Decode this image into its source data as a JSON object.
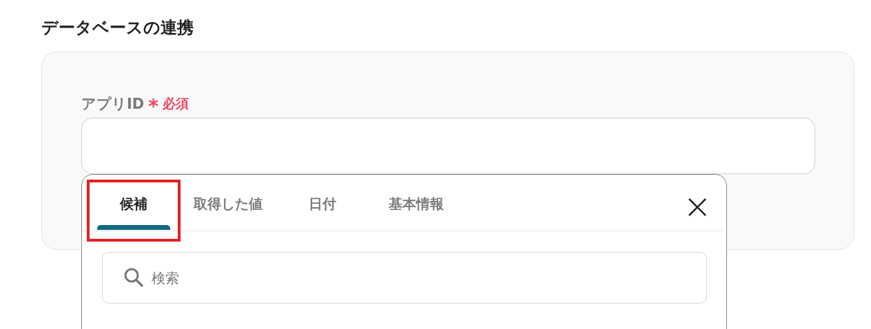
{
  "section_title": "データベースの連携",
  "field": {
    "label": "アプリID",
    "required_mark": "*",
    "required_text": "必須"
  },
  "popup": {
    "tabs": [
      {
        "label": "候補",
        "selected": true,
        "highlighted": true
      },
      {
        "label": "取得した値",
        "selected": false,
        "highlighted": false
      },
      {
        "label": "日付",
        "selected": false,
        "highlighted": false
      },
      {
        "label": "基本情報",
        "selected": false,
        "highlighted": false
      }
    ],
    "search": {
      "placeholder": "検索"
    }
  }
}
